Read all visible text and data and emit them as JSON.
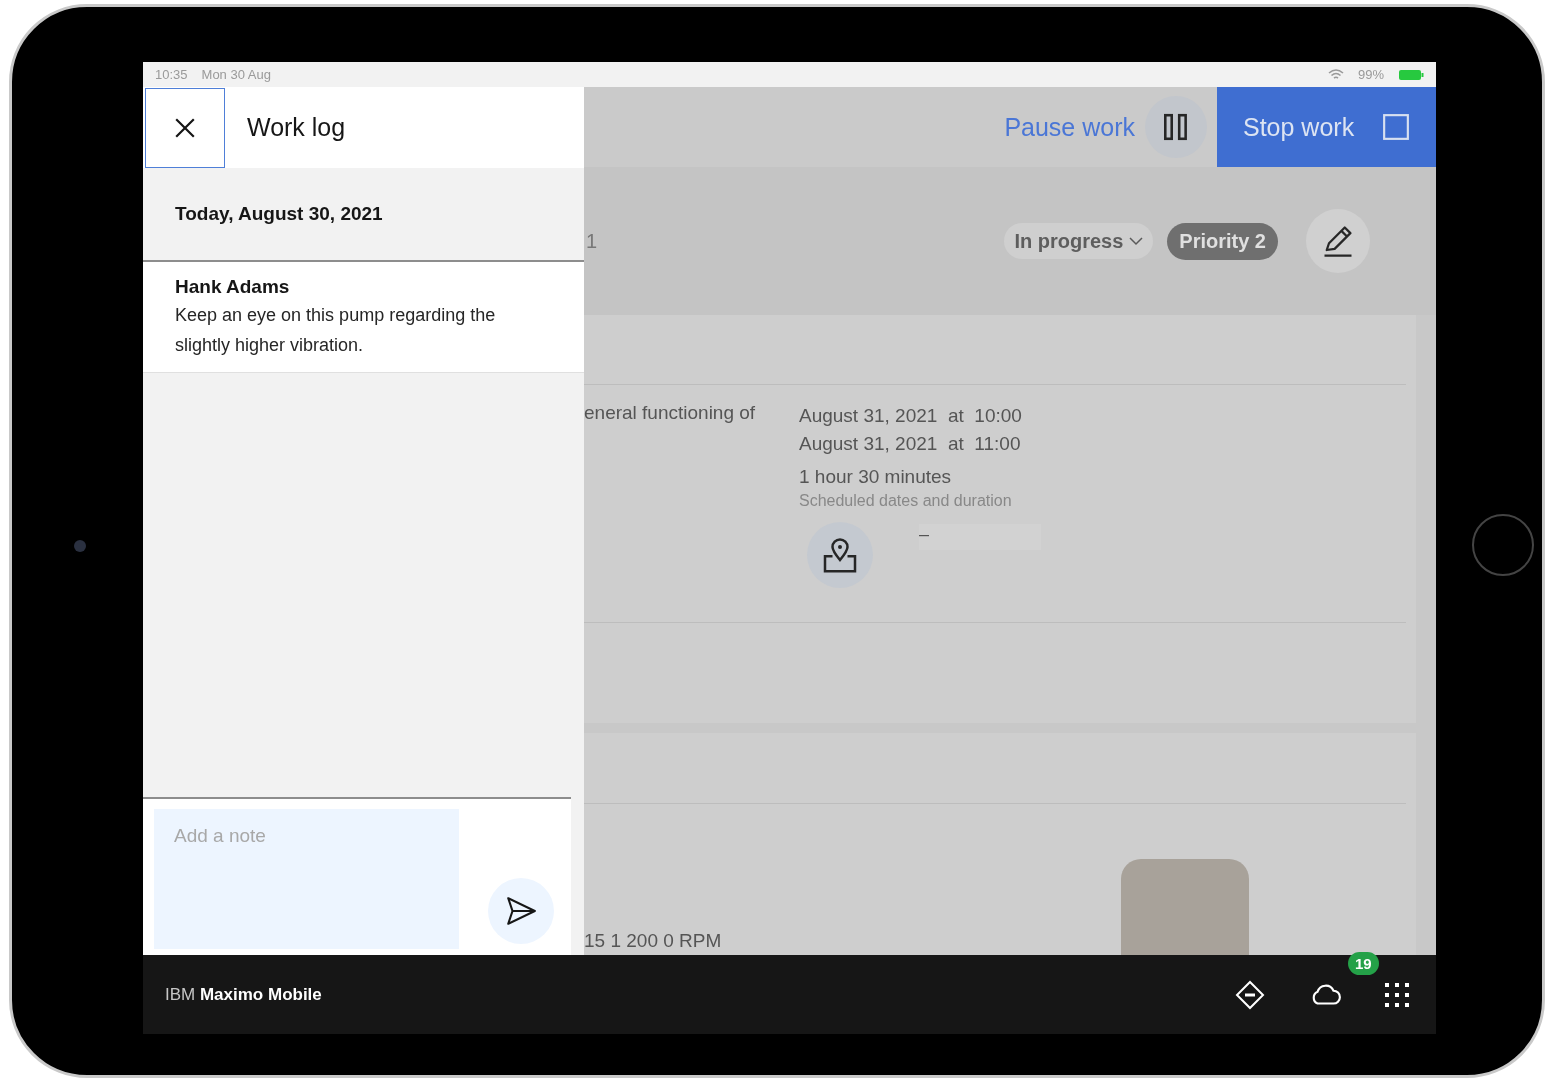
{
  "status_bar": {
    "time": "10:35",
    "date": "Mon 30 Aug",
    "battery": "99%"
  },
  "work_log": {
    "title": "Work log",
    "date_heading": "Today, August 30, 2021",
    "entries": [
      {
        "author": "Hank Adams",
        "text": "Keep an eye on this pump regarding the slightly higher vibration."
      }
    ],
    "note": {
      "placeholder": "Add a note"
    }
  },
  "header": {
    "pause_label": "Pause work",
    "stop_label": "Stop work"
  },
  "work_order": {
    "id_fragment": "1",
    "status": "In progress",
    "priority": "Priority 2",
    "description_fragment": "eneral functioning of",
    "scheduled_start": "August 31, 2021  at  10:00",
    "scheduled_finish": "August 31, 2021  at  11:00",
    "duration": "1 hour 30 minutes",
    "duration_label": "Scheduled dates and duration",
    "location_value": "–",
    "asset_fragment": "15  1 200 0 RPM"
  },
  "app_bar": {
    "brand": "IBM **Maximo Mobile**",
    "badge": "19"
  }
}
